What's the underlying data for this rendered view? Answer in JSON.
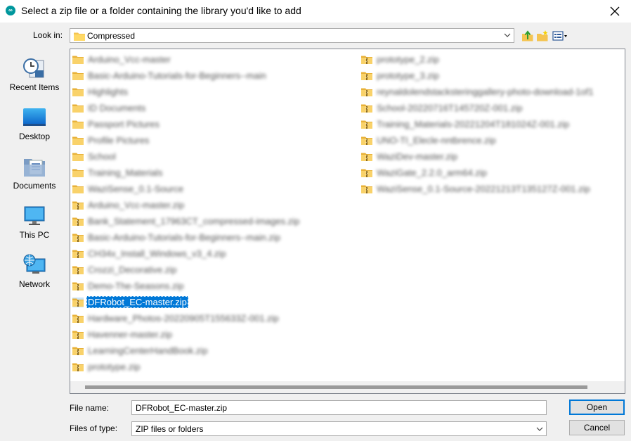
{
  "window": {
    "title": "Select a zip file or a folder containing the library you'd like to add"
  },
  "lookin": {
    "label": "Look in:",
    "value": "Compressed"
  },
  "places": [
    {
      "label": "Recent Items",
      "icon": "recent-items-icon"
    },
    {
      "label": "Desktop",
      "icon": "desktop-icon"
    },
    {
      "label": "Documents",
      "icon": "documents-icon"
    },
    {
      "label": "This PC",
      "icon": "this-pc-icon"
    },
    {
      "label": "Network",
      "icon": "network-icon"
    }
  ],
  "files": {
    "col1": [
      {
        "name": "Arduino_Vcc-master",
        "type": "folder",
        "blurred": true
      },
      {
        "name": "Basic-Arduino-Tutorials-for-Beginners--main",
        "type": "folder",
        "blurred": true
      },
      {
        "name": "Highlights",
        "type": "folder",
        "blurred": true
      },
      {
        "name": "ID Documents",
        "type": "folder",
        "blurred": true
      },
      {
        "name": "Passport Pictures",
        "type": "folder",
        "blurred": true
      },
      {
        "name": "Profile Pictures",
        "type": "folder",
        "blurred": true
      },
      {
        "name": "School",
        "type": "folder",
        "blurred": true
      },
      {
        "name": "Training_Materials",
        "type": "folder",
        "blurred": true
      },
      {
        "name": "WaziSense_0.1-Source",
        "type": "folder",
        "blurred": true
      },
      {
        "name": "Arduino_Vcc-master.zip",
        "type": "zip",
        "blurred": true
      },
      {
        "name": "Bank_Statement_17963CT_compressed-images.zip",
        "type": "zip",
        "blurred": true
      },
      {
        "name": "Basic-Arduino-Tutorials-for-Beginners--main.zip",
        "type": "zip",
        "blurred": true
      },
      {
        "name": "CH34x_Install_Windows_v3_4.zip",
        "type": "zip",
        "blurred": true
      },
      {
        "name": "Crozzi_Decorative.zip",
        "type": "zip",
        "blurred": true
      },
      {
        "name": "Demo-The-Seasons.zip",
        "type": "zip",
        "blurred": true
      },
      {
        "name": "DFRobot_EC-master.zip",
        "type": "zip",
        "blurred": false,
        "selected": true
      },
      {
        "name": "Hardware_Photos-20220905T155633Z-001.zip",
        "type": "zip",
        "blurred": true
      },
      {
        "name": "Havenner-master.zip",
        "type": "zip",
        "blurred": true
      },
      {
        "name": "LearningCenterHandBook.zip",
        "type": "zip",
        "blurred": true
      },
      {
        "name": "prototype.zip",
        "type": "zip",
        "blurred": true
      }
    ],
    "col2": [
      {
        "name": "prototype_2.zip",
        "type": "zip",
        "blurred": true
      },
      {
        "name": "prototype_3.zip",
        "type": "zip",
        "blurred": true
      },
      {
        "name": "reynaldolendstacksteringgallery-photo-download-1of1",
        "type": "zip",
        "blurred": true
      },
      {
        "name": "School-20220716T145720Z-001.zip",
        "type": "zip",
        "blurred": true
      },
      {
        "name": "Training_Materials-20221204T181024Z-001.zip",
        "type": "zip",
        "blurred": true
      },
      {
        "name": "UNO-TI_Elecle-nntbrence.zip",
        "type": "zip",
        "blurred": true
      },
      {
        "name": "WaziDev-master.zip",
        "type": "zip",
        "blurred": true
      },
      {
        "name": "WaziGate_2.2.0_arm64.zip",
        "type": "zip",
        "blurred": true
      },
      {
        "name": "WaziSense_0.1-Source-20221213T135127Z-001.zip",
        "type": "zip",
        "blurred": true
      }
    ]
  },
  "filename": {
    "label": "File name:",
    "value": "DFRobot_EC-master.zip"
  },
  "filetype": {
    "label": "Files of type:",
    "value": "ZIP files or folders"
  },
  "buttons": {
    "open": "Open",
    "cancel": "Cancel"
  },
  "colors": {
    "accent": "#0078d7",
    "folder": "#f4c451",
    "arduino": "#00979d"
  }
}
